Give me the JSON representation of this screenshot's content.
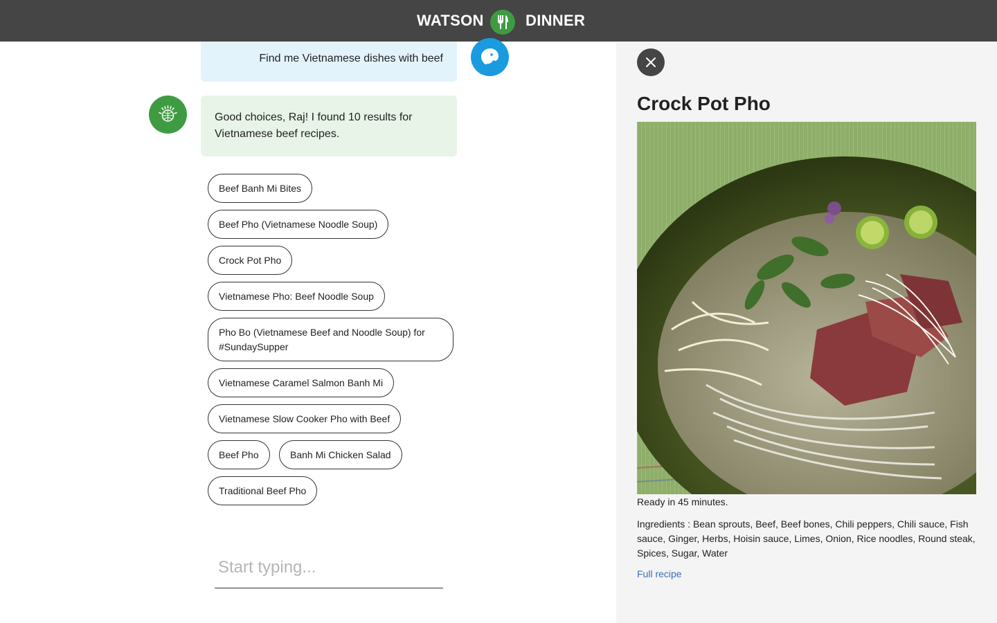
{
  "header": {
    "brand_left": "WATSON",
    "brand_right": "DINNER",
    "logo_icon": "fork-knife-icon",
    "background": "#454545",
    "logo_color": "#3f9b42"
  },
  "chat": {
    "user_message": "Find me Vietnamese dishes with beef",
    "user_avatar_icon": "user-profile-icon",
    "bot_avatar_icon": "watson-globe-icon",
    "bot_message": "Good choices, Raj! I found 10 results for Vietnamese beef recipes.",
    "results": [
      "Beef Banh Mi Bites",
      "Beef Pho (Vietnamese Noodle Soup)",
      "Crock Pot Pho",
      "Vietnamese Pho: Beef Noodle Soup",
      "Pho Bo (Vietnamese Beef and Noodle Soup) for #SundaySupper",
      "Vietnamese Caramel Salmon Banh Mi",
      "Vietnamese Slow Cooker Pho with Beef",
      "Beef Pho",
      "Banh Mi Chicken Salad",
      "Traditional Beef Pho"
    ],
    "input_placeholder": "Start typing...",
    "input_value": ""
  },
  "detail": {
    "close_icon": "close-icon",
    "title": "Crock Pot Pho",
    "image_alt": "Bowl of beef pho with noodles, bean sprouts, herbs and limes",
    "ready_text": "Ready in 45 minutes.",
    "ingredients_text": "Ingredients : Bean sprouts, Beef, Beef bones, Chili peppers, Chili sauce, Fish sauce, Ginger, Herbs, Hoisin sauce, Limes, Onion, Rice noodles, Round steak, Spices, Sugar, Water",
    "full_recipe_label": "Full recipe"
  }
}
